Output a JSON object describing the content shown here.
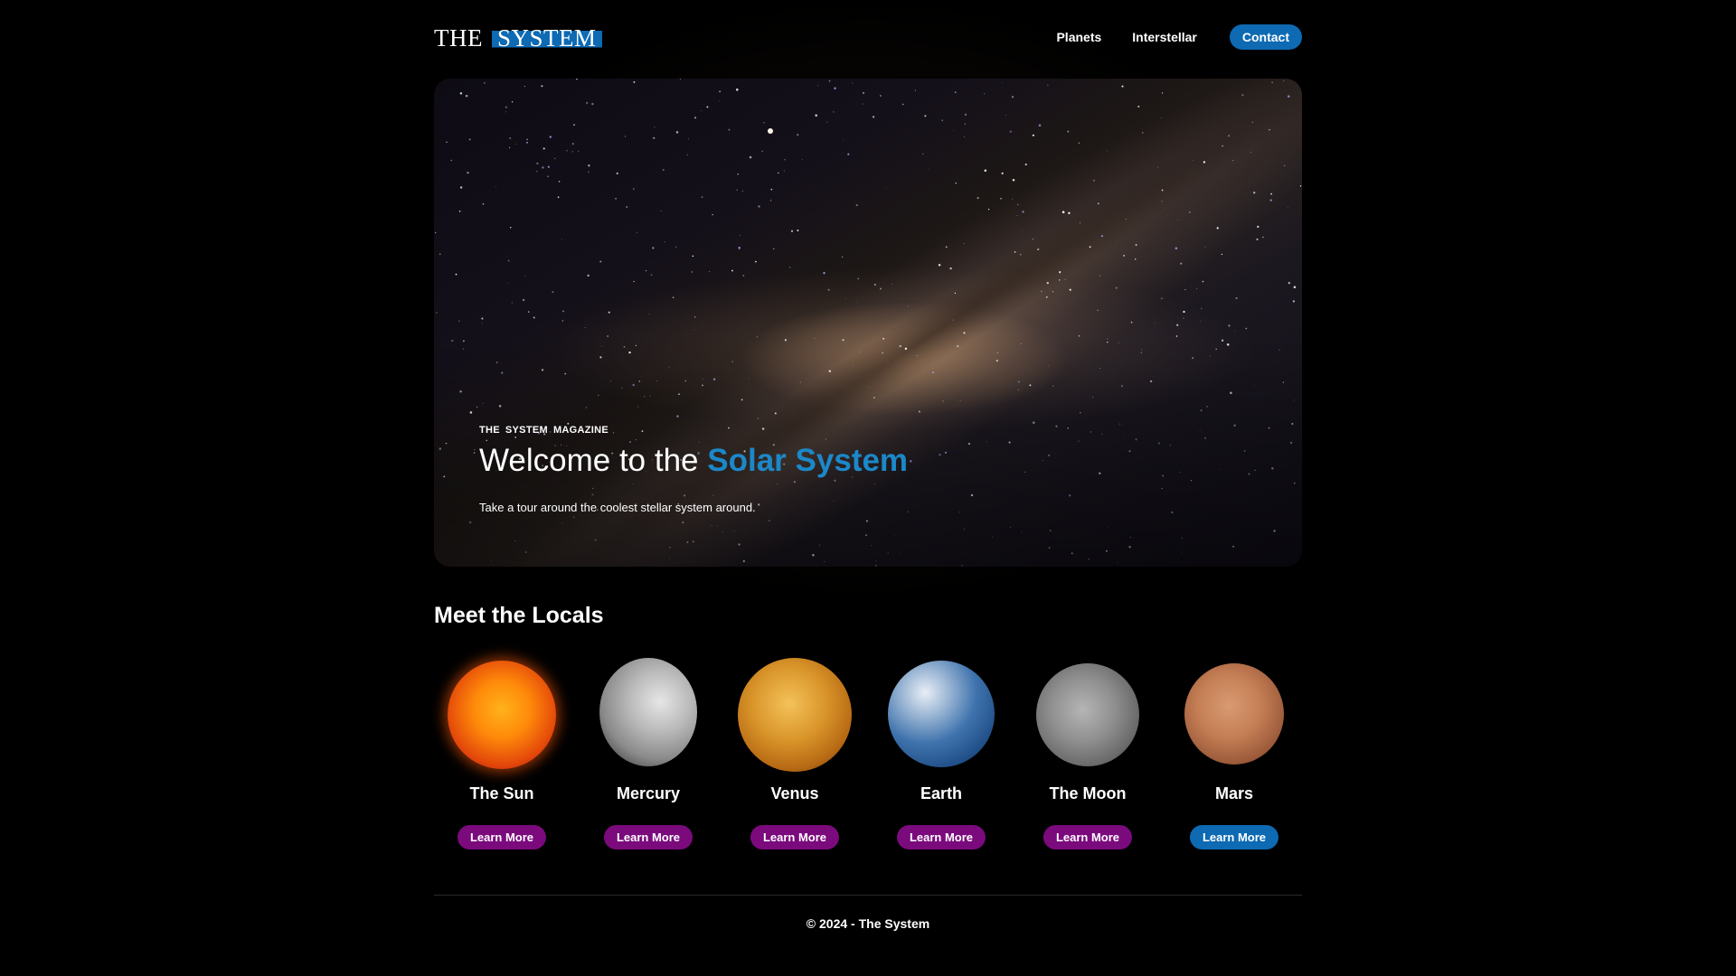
{
  "header": {
    "logo_the": "THE",
    "logo_system": "SYSTEM",
    "nav": [
      {
        "label": "Planets"
      },
      {
        "label": "Interstellar"
      },
      {
        "label": "Contact"
      }
    ]
  },
  "hero": {
    "kicker": [
      "THE",
      "SYSTEM",
      "MAGAZINE"
    ],
    "headline_prefix": "Welcome to the ",
    "headline_accent": "Solar System",
    "tagline": "Take a tour around the coolest stellar system around.",
    "accent_color": "#1b88c9"
  },
  "locals": {
    "title": "Meet the Locals",
    "items": [
      {
        "name": "The Sun",
        "button": "Learn More",
        "icon": "sun-icon"
      },
      {
        "name": "Mercury",
        "button": "Learn More",
        "icon": "mercury-icon"
      },
      {
        "name": "Venus",
        "button": "Learn More",
        "icon": "venus-icon"
      },
      {
        "name": "Earth",
        "button": "Learn More",
        "icon": "earth-icon"
      },
      {
        "name": "The Moon",
        "button": "Learn More",
        "icon": "moon-icon"
      },
      {
        "name": "Mars",
        "button": "Learn More",
        "icon": "mars-icon"
      }
    ]
  },
  "footer": {
    "text": "© 2024 - The System"
  },
  "colors": {
    "brand_blue": "#0d6ab3",
    "button_purple": "#7b0a7d"
  }
}
